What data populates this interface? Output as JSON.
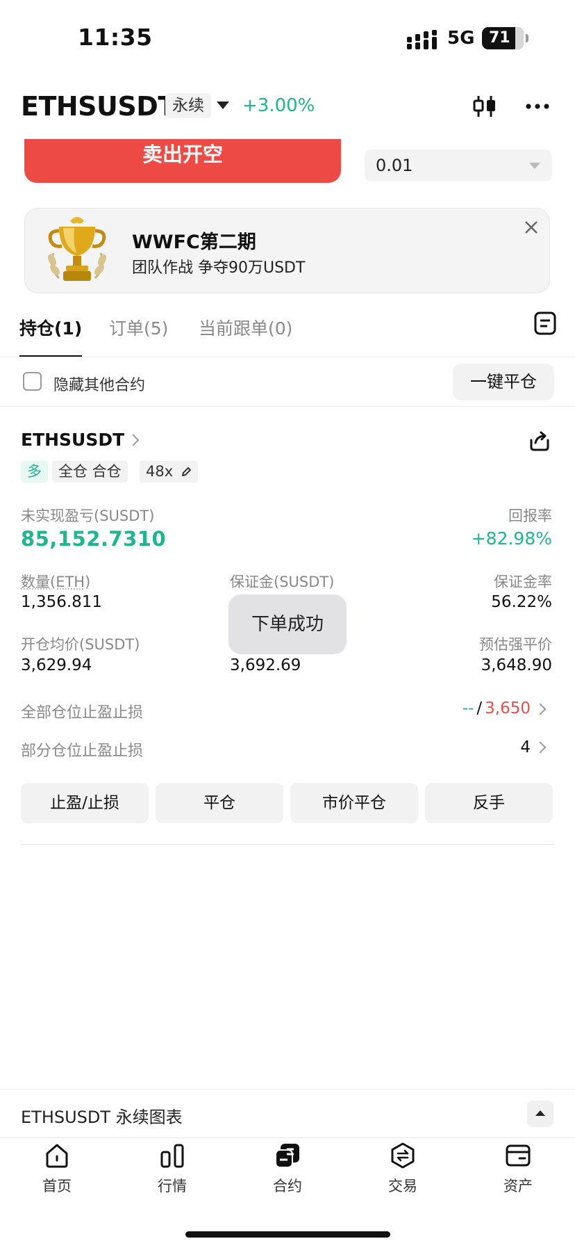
{
  "status_bar": {
    "time": "11:35",
    "network": "5G",
    "battery": "71"
  },
  "header": {
    "symbol": "ETHSUSDT",
    "contract_type": "永续",
    "change": "+3.00%"
  },
  "order": {
    "sell_label": "卖出开空",
    "quantity": "0.01"
  },
  "banner": {
    "title": "WWFC第二期",
    "subtitle": "团队作战 争夺90万USDT"
  },
  "tabs": [
    {
      "label": "持仓(1)",
      "active": true
    },
    {
      "label": "订单(5)",
      "active": false
    },
    {
      "label": "当前跟单(0)",
      "active": false
    }
  ],
  "filter": {
    "hide_label": "隐藏其他合约",
    "close_all_label": "一键平仓"
  },
  "position": {
    "symbol": "ETHSUSDT",
    "side": "多",
    "margin_mode": "全仓 合仓",
    "leverage": "48x",
    "unrealized_pnl_label": "未实现盈亏(SUSDT)",
    "unrealized_pnl": "85,152.7310",
    "roe_label": "回报率",
    "roe": "+82.98%",
    "size_label": "数量(ETH)",
    "size": "1,356.811",
    "margin_label": "保证金(SUSDT)",
    "margin_ratio_label": "保证金率",
    "margin_ratio": "56.22%",
    "entry_label": "开仓均价(SUSDT)",
    "entry": "3,629.94",
    "mark_price": "3,692.69",
    "liq_label": "预估强平价",
    "liq": "3,648.90",
    "full_tpsl_label": "全部仓位止盈止损",
    "full_tp": "--",
    "full_sep": "/",
    "full_sl": "3,650",
    "partial_tpsl_label": "部分仓位止盈止损",
    "partial_count": "4",
    "actions": [
      "止盈/止损",
      "平仓",
      "市价平仓",
      "反手"
    ]
  },
  "toast": "下单成功",
  "chart_footer": {
    "label": "ETHSUSDT 永续图表"
  },
  "bottom_nav": [
    {
      "label": "首页",
      "icon": "home-icon"
    },
    {
      "label": "行情",
      "icon": "market-icon"
    },
    {
      "label": "合约",
      "icon": "futures-icon"
    },
    {
      "label": "交易",
      "icon": "trade-icon"
    },
    {
      "label": "资产",
      "icon": "wallet-icon"
    }
  ],
  "colors": {
    "green": "#1fb58f",
    "red": "#ee4a45",
    "toast_bg": "#e1e1e4"
  }
}
